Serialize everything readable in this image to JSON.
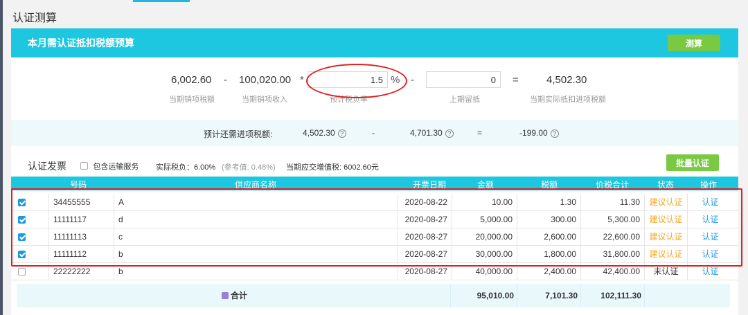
{
  "page": {
    "title": "认证测算"
  },
  "panel": {
    "title": "本月需认证抵扣税额预算",
    "calc_button": "测算"
  },
  "formula": {
    "output_tax": {
      "value": "6,002.60",
      "label": "当期销项税额"
    },
    "op_minus1": "-",
    "sales_income": {
      "value": "100,020.00",
      "label": "当期销项收入"
    },
    "op_multiply": "*",
    "tax_burden": {
      "value": "1.5",
      "unit": "%",
      "label": "预计税负率"
    },
    "op_minus2": "-",
    "retained": {
      "value": "0",
      "label": "上期留抵"
    },
    "op_equals": "=",
    "result": {
      "value": "4,502.30",
      "label": "当期实际抵扣进项税额"
    }
  },
  "need": {
    "label": "预计还需进项税额:",
    "value1": "4,502.30",
    "op_minus": "-",
    "value2": "4,701.30",
    "op_equals": "=",
    "value3": "-199.00",
    "help": "?"
  },
  "invoices": {
    "title": "认证发票",
    "include_transport": "包含运输服务",
    "actual_tax_label": "实际税负：6.00%",
    "reference": "(参考值: 0.48%)",
    "payable_label": "当期应交增值税: 6002.60元",
    "batch_button": "批量认证"
  },
  "table": {
    "headers": [
      "号码",
      "供应商名称",
      "开票日期",
      "金额",
      "税额",
      "价税合计",
      "状态",
      "操作"
    ],
    "rows": [
      {
        "checked": true,
        "number": "34455555",
        "supplier": "A",
        "date": "2020-08-22",
        "amount": "10.00",
        "tax": "1.30",
        "total": "11.30",
        "status": "建议认证",
        "action": "认证"
      },
      {
        "checked": true,
        "number": "11111117",
        "supplier": "d",
        "date": "2020-08-27",
        "amount": "5,000.00",
        "tax": "300.00",
        "total": "5,300.00",
        "status": "建议认证",
        "action": "认证"
      },
      {
        "checked": true,
        "number": "11111113",
        "supplier": "c",
        "date": "2020-08-27",
        "amount": "20,000.00",
        "tax": "2,600.00",
        "total": "22,600.00",
        "status": "建议认证",
        "action": "认证"
      },
      {
        "checked": true,
        "number": "11111112",
        "supplier": "b",
        "date": "2020-08-27",
        "amount": "30,000.00",
        "tax": "1,800.00",
        "total": "31,800.00",
        "status": "建议认证",
        "action": "认证"
      },
      {
        "checked": false,
        "number": "22222222",
        "supplier": "b",
        "date": "2020-08-27",
        "amount": "40,000.00",
        "tax": "2,400.00",
        "total": "42,400.00",
        "status": "未认证",
        "action": "认证"
      }
    ],
    "totals": {
      "label": "合计",
      "amount": "95,010.00",
      "tax": "7,101.30",
      "total": "102,111.30"
    }
  },
  "colors": {
    "header": "#1cc7df",
    "button_green": "#7ac943",
    "highlight_red": "#e02020",
    "status_orange": "#f5a623",
    "link_blue": "#1a9be0"
  }
}
